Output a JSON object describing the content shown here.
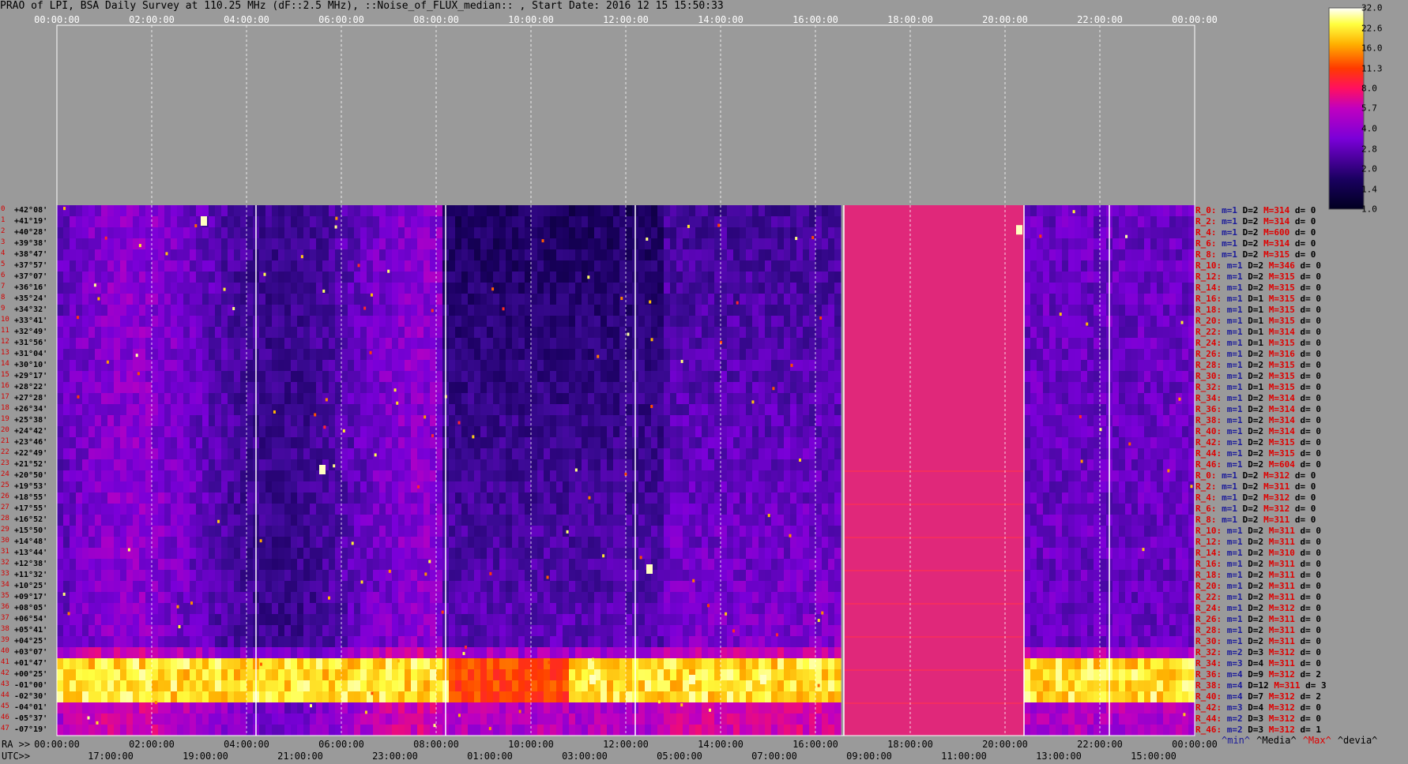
{
  "title": "PRAO of LPI, BSA Daily Survey at 110.25 MHz (dF::2.5 MHz), ::Noise_of_FLUX_median:: , Start Date: 2016 12 15 15:50:33",
  "axis_labels": {
    "ra": "RA >>",
    "utc": "UTC>>"
  },
  "top_ticks": [
    "00:00:00",
    "02:00:00",
    "04:00:00",
    "06:00:00",
    "08:00:00",
    "10:00:00",
    "12:00:00",
    "14:00:00",
    "16:00:00",
    "18:00:00",
    "20:00:00",
    "22:00:00",
    "00:00:00"
  ],
  "bottom_ra_ticks": [
    "00:00:00",
    "02:00:00",
    "04:00:00",
    "06:00:00",
    "08:00:00",
    "10:00:00",
    "12:00:00",
    "14:00:00",
    "16:00:00",
    "18:00:00",
    "20:00:00",
    "22:00:00",
    "00:00:00"
  ],
  "bottom_utc_ticks": [
    "17:00:00",
    "19:00:00",
    "21:00:00",
    "23:00:00",
    "01:00:00",
    "03:00:00",
    "05:00:00",
    "07:00:00",
    "09:00:00",
    "11:00:00",
    "13:00:00",
    "15:00:00"
  ],
  "legend_bottom": [
    {
      "text": "^min^",
      "color": "#1a1a9a"
    },
    {
      "text": "^Media^",
      "color": "#000000"
    },
    {
      "text": "^Max^",
      "color": "#e00000"
    },
    {
      "text": "^devia^",
      "color": "#000000"
    }
  ],
  "colorbar_ticks": [
    "32.0",
    "22.6",
    "16.0",
    "11.3",
    "8.0",
    "5.7",
    "4.0",
    "2.8",
    "2.0",
    "1.4",
    "1.0"
  ],
  "declinations": [
    "+42°08'",
    "+41°19'",
    "+40°28'",
    "+39°38'",
    "+38°47'",
    "+37°57'",
    "+37°07'",
    "+36°16'",
    "+35°24'",
    "+34°32'",
    "+33°41'",
    "+32°49'",
    "+31°56'",
    "+31°04'",
    "+30°10'",
    "+29°17'",
    "+28°22'",
    "+27°28'",
    "+26°34'",
    "+25°38'",
    "+24°42'",
    "+23°46'",
    "+22°49'",
    "+21°52'",
    "+20°50'",
    "+19°53'",
    "+18°55'",
    "+17°55'",
    "+16°52'",
    "+15°50'",
    "+14°48'",
    "+13°44'",
    "+12°38'",
    "+11°32'",
    "+10°25'",
    "+09°17'",
    "+08°05'",
    "+06°54'",
    "+05°41'",
    "+04°25'",
    "+03°07'",
    "+01°47'",
    "+00°25'",
    "-01°00'",
    "-02°30'",
    "-04°01'",
    "-05°37'",
    "-07°19'"
  ],
  "row_numbers": [
    "0",
    "1",
    "2",
    "3",
    "4",
    "5",
    "6",
    "7",
    "8",
    "9",
    "10",
    "11",
    "12",
    "13",
    "14",
    "15",
    "16",
    "17",
    "18",
    "19",
    "20",
    "21",
    "22",
    "23",
    "24",
    "25",
    "26",
    "27",
    "28",
    "29",
    "30",
    "31",
    "32",
    "33",
    "34",
    "35",
    "36",
    "37",
    "38",
    "39",
    "40",
    "41",
    "42",
    "43",
    "44",
    "45",
    "46",
    "47"
  ],
  "stats": [
    {
      "r": "R_0:",
      "m": "m=1",
      "d": "D=2",
      "mx": "M=314",
      "dd": "d= 0"
    },
    {
      "r": "R_2:",
      "m": "m=1",
      "d": "D=2",
      "mx": "M=314",
      "dd": "d= 0"
    },
    {
      "r": "R_4:",
      "m": "m=1",
      "d": "D=2",
      "mx": "M=600",
      "dd": "d= 0"
    },
    {
      "r": "R_6:",
      "m": "m=1",
      "d": "D=2",
      "mx": "M=314",
      "dd": "d= 0"
    },
    {
      "r": "R_8:",
      "m": "m=1",
      "d": "D=2",
      "mx": "M=315",
      "dd": "d= 0"
    },
    {
      "r": "R_10:",
      "m": "m=1",
      "d": "D=2",
      "mx": "M=346",
      "dd": "d= 0"
    },
    {
      "r": "R_12:",
      "m": "m=1",
      "d": "D=2",
      "mx": "M=315",
      "dd": "d= 0"
    },
    {
      "r": "R_14:",
      "m": "m=1",
      "d": "D=2",
      "mx": "M=315",
      "dd": "d= 0"
    },
    {
      "r": "R_16:",
      "m": "m=1",
      "d": "D=1",
      "mx": "M=315",
      "dd": "d= 0"
    },
    {
      "r": "R_18:",
      "m": "m=1",
      "d": "D=1",
      "mx": "M=315",
      "dd": "d= 0"
    },
    {
      "r": "R_20:",
      "m": "m=1",
      "d": "D=1",
      "mx": "M=315",
      "dd": "d= 0"
    },
    {
      "r": "R_22:",
      "m": "m=1",
      "d": "D=1",
      "mx": "M=314",
      "dd": "d= 0"
    },
    {
      "r": "R_24:",
      "m": "m=1",
      "d": "D=1",
      "mx": "M=315",
      "dd": "d= 0"
    },
    {
      "r": "R_26:",
      "m": "m=1",
      "d": "D=2",
      "mx": "M=316",
      "dd": "d= 0"
    },
    {
      "r": "R_28:",
      "m": "m=1",
      "d": "D=2",
      "mx": "M=315",
      "dd": "d= 0"
    },
    {
      "r": "R_30:",
      "m": "m=1",
      "d": "D=2",
      "mx": "M=315",
      "dd": "d= 0"
    },
    {
      "r": "R_32:",
      "m": "m=1",
      "d": "D=1",
      "mx": "M=315",
      "dd": "d= 0"
    },
    {
      "r": "R_34:",
      "m": "m=1",
      "d": "D=2",
      "mx": "M=314",
      "dd": "d= 0"
    },
    {
      "r": "R_36:",
      "m": "m=1",
      "d": "D=2",
      "mx": "M=314",
      "dd": "d= 0"
    },
    {
      "r": "R_38:",
      "m": "m=1",
      "d": "D=2",
      "mx": "M=314",
      "dd": "d= 0"
    },
    {
      "r": "R_40:",
      "m": "m=1",
      "d": "D=2",
      "mx": "M=314",
      "dd": "d= 0"
    },
    {
      "r": "R_42:",
      "m": "m=1",
      "d": "D=2",
      "mx": "M=315",
      "dd": "d= 0"
    },
    {
      "r": "R_44:",
      "m": "m=1",
      "d": "D=2",
      "mx": "M=315",
      "dd": "d= 0"
    },
    {
      "r": "R_46:",
      "m": "m=1",
      "d": "D=2",
      "mx": "M=604",
      "dd": "d= 0"
    },
    {
      "r": "R_0:",
      "m": "m=1",
      "d": "D=2",
      "mx": "M=312",
      "dd": "d= 0"
    },
    {
      "r": "R_2:",
      "m": "m=1",
      "d": "D=2",
      "mx": "M=311",
      "dd": "d= 0"
    },
    {
      "r": "R_4:",
      "m": "m=1",
      "d": "D=2",
      "mx": "M=312",
      "dd": "d= 0"
    },
    {
      "r": "R_6:",
      "m": "m=1",
      "d": "D=2",
      "mx": "M=312",
      "dd": "d= 0"
    },
    {
      "r": "R_8:",
      "m": "m=1",
      "d": "D=2",
      "mx": "M=311",
      "dd": "d= 0"
    },
    {
      "r": "R_10:",
      "m": "m=1",
      "d": "D=2",
      "mx": "M=311",
      "dd": "d= 0"
    },
    {
      "r": "R_12:",
      "m": "m=1",
      "d": "D=2",
      "mx": "M=311",
      "dd": "d= 0"
    },
    {
      "r": "R_14:",
      "m": "m=1",
      "d": "D=2",
      "mx": "M=310",
      "dd": "d= 0"
    },
    {
      "r": "R_16:",
      "m": "m=1",
      "d": "D=2",
      "mx": "M=311",
      "dd": "d= 0"
    },
    {
      "r": "R_18:",
      "m": "m=1",
      "d": "D=2",
      "mx": "M=311",
      "dd": "d= 0"
    },
    {
      "r": "R_20:",
      "m": "m=1",
      "d": "D=2",
      "mx": "M=311",
      "dd": "d= 0"
    },
    {
      "r": "R_22:",
      "m": "m=1",
      "d": "D=2",
      "mx": "M=311",
      "dd": "d= 0"
    },
    {
      "r": "R_24:",
      "m": "m=1",
      "d": "D=2",
      "mx": "M=312",
      "dd": "d= 0"
    },
    {
      "r": "R_26:",
      "m": "m=1",
      "d": "D=2",
      "mx": "M=311",
      "dd": "d= 0"
    },
    {
      "r": "R_28:",
      "m": "m=1",
      "d": "D=2",
      "mx": "M=311",
      "dd": "d= 0"
    },
    {
      "r": "R_30:",
      "m": "m=1",
      "d": "D=2",
      "mx": "M=311",
      "dd": "d= 0"
    },
    {
      "r": "R_32:",
      "m": "m=2",
      "d": "D=3",
      "mx": "M=312",
      "dd": "d= 0"
    },
    {
      "r": "R_34:",
      "m": "m=3",
      "d": "D=4",
      "mx": "M=311",
      "dd": "d= 0"
    },
    {
      "r": "R_36:",
      "m": "m=4",
      "d": "D=9",
      "mx": "M=312",
      "dd": "d= 2"
    },
    {
      "r": "R_38:",
      "m": "m=4",
      "d": "D=12",
      "mx": "M=311",
      "dd": "d= 3"
    },
    {
      "r": "R_40:",
      "m": "m=4",
      "d": "D=7",
      "mx": "M=312",
      "dd": "d= 2"
    },
    {
      "r": "R_42:",
      "m": "m=3",
      "d": "D=4",
      "mx": "M=312",
      "dd": "d= 0"
    },
    {
      "r": "R_44:",
      "m": "m=2",
      "d": "D=3",
      "mx": "M=312",
      "dd": "d= 0"
    },
    {
      "r": "R_46:",
      "m": "m=2",
      "d": "D=3",
      "mx": "M=312",
      "dd": "d= 1"
    }
  ],
  "chart_data": {
    "type": "heatmap",
    "title": "PRAO of LPI, BSA Daily Survey at 110.25 MHz (dF::2.5 MHz), ::Noise_of_FLUX_median:: , Start Date: 2016 12 15 15:50:33",
    "x_ra_ticks": [
      "00:00:00",
      "02:00:00",
      "04:00:00",
      "06:00:00",
      "08:00:00",
      "10:00:00",
      "12:00:00",
      "14:00:00",
      "16:00:00",
      "18:00:00",
      "20:00:00",
      "22:00:00",
      "00:00:00"
    ],
    "x_utc_ticks": [
      "17:00:00",
      "19:00:00",
      "21:00:00",
      "23:00:00",
      "01:00:00",
      "03:00:00",
      "05:00:00",
      "07:00:00",
      "09:00:00",
      "11:00:00",
      "13:00:00",
      "15:00:00"
    ],
    "rows": 48,
    "colorbar": {
      "min": 1.0,
      "max": 32.0,
      "scale": "log",
      "ticks": [
        32.0,
        22.6,
        16.0,
        11.3,
        8.0,
        5.7,
        4.0,
        2.8,
        2.0,
        1.4,
        1.0
      ]
    },
    "colors": {
      "low": "#000020",
      "mid": "#8a00e0",
      "high": "#ff1f1f",
      "peak": "#ffff60",
      "top": "#ffffff",
      "saturated_band": "#e0287a"
    }
  }
}
